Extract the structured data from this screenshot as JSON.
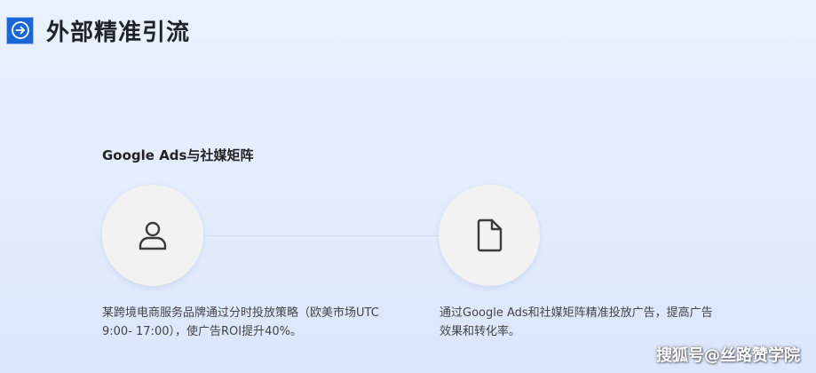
{
  "header": {
    "icon": "arrow-right-circle-icon",
    "title": "外部精准引流"
  },
  "section": {
    "title": "Google Ads与社媒矩阵"
  },
  "steps": [
    {
      "icon": "user-icon",
      "description": "某跨境电商服务品牌通过分时投放策略（欧美市场UTC 9:00- 17:00），使广告ROI提升40%。"
    },
    {
      "icon": "document-icon",
      "description": "通过Google Ads和社媒矩阵精准投放广告，提高广告效果和转化率。"
    }
  ],
  "watermark": "搜狐号@丝路赞学院",
  "colors": {
    "accent": "#1a66d6",
    "circle": "#f2f2f3"
  }
}
